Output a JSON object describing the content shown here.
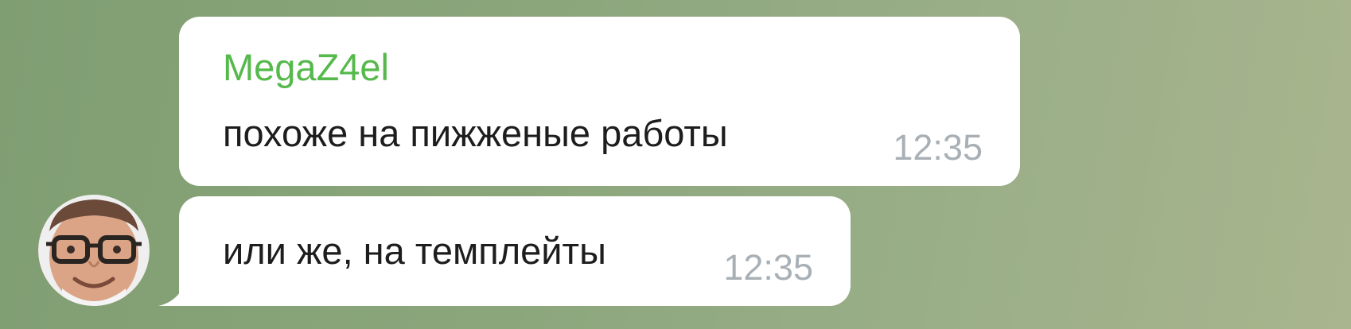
{
  "messages": [
    {
      "sender": "MegaZ4el",
      "text": "похоже на пижженые работы",
      "time": "12:35"
    },
    {
      "text": "или же, на темплейты",
      "time": "12:35"
    }
  ],
  "avatar": {
    "icon": "user-avatar-photo"
  },
  "colors": {
    "sender_name": "#56b94c",
    "bubble": "#ffffff",
    "time": "#a8b0b6",
    "background": "#8aa57a"
  }
}
